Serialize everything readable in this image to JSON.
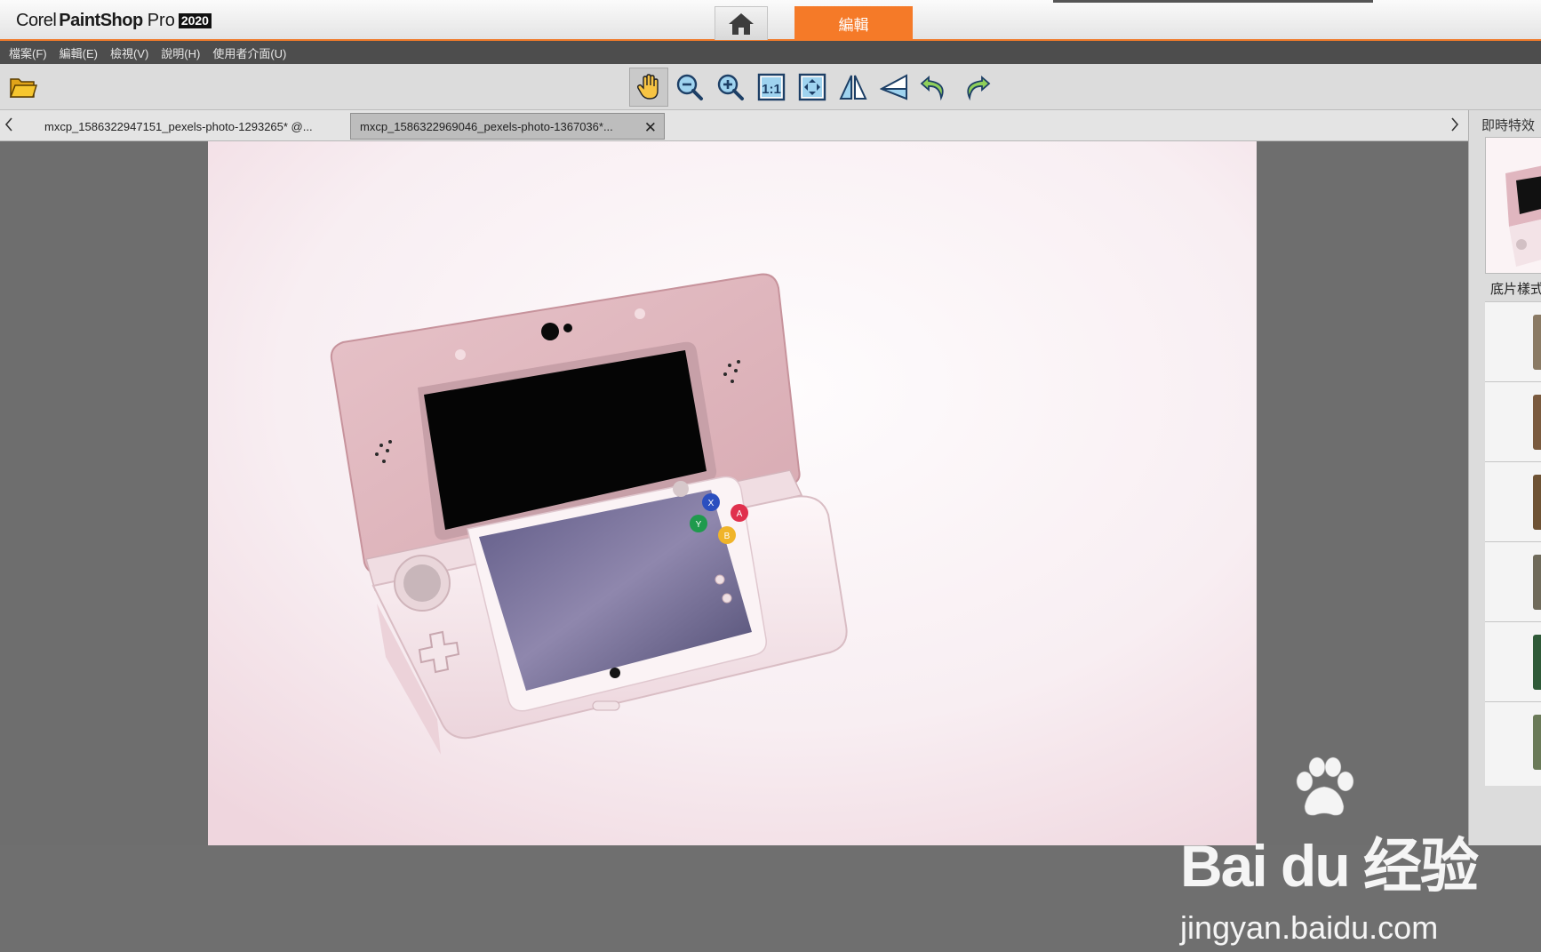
{
  "app": {
    "logo_corel": "Corel",
    "logo_paintshop": "PaintShop",
    "logo_pro": "Pro",
    "logo_year": "2020"
  },
  "mode_tabs": {
    "home_icon": "home-icon",
    "edit_label": "編輯",
    "accent_color": "#f57a28"
  },
  "menu": {
    "items": [
      "檔案(F)",
      "編輯(E)",
      "檢視(V)",
      "說明(H)",
      "使用者介面(U)"
    ]
  },
  "toolbar": {
    "tools": [
      "pan-hand-icon",
      "zoom-out-icon",
      "zoom-in-icon",
      "actual-size-icon",
      "fit-window-icon",
      "flip-horizontal-icon",
      "flip-vertical-icon",
      "rotate-left-icon",
      "rotate-right-icon"
    ]
  },
  "document_tabs": {
    "tab1": "mxcp_1586322947151_pexels-photo-1293265* @...",
    "tab2": "mxcp_1586322969046_pexels-photo-1367036*...",
    "close_glyph": "✕"
  },
  "right_panel": {
    "title": "即時特效",
    "film_style_label": "底片樣式"
  },
  "watermark": {
    "brand": "Bai du 经验",
    "url": "jingyan.baidu.com"
  }
}
